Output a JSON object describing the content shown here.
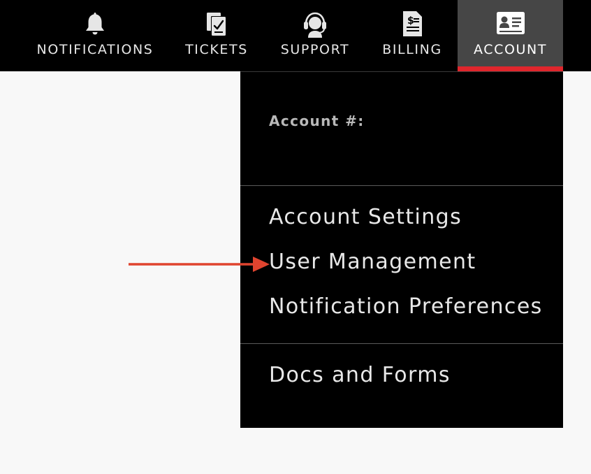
{
  "nav": {
    "items": [
      {
        "label": "NOTIFICATIONS",
        "icon": "bell-icon"
      },
      {
        "label": "TICKETS",
        "icon": "tickets-icon"
      },
      {
        "label": "SUPPORT",
        "icon": "headset-icon"
      },
      {
        "label": "BILLING",
        "icon": "invoice-icon"
      },
      {
        "label": "ACCOUNT",
        "icon": "id-card-icon",
        "active": true
      }
    ],
    "active_color": "#e0262c"
  },
  "account_menu": {
    "account_number_label": "Account #:",
    "items": [
      {
        "label": "Account Settings"
      },
      {
        "label": "User Management"
      },
      {
        "label": "Notification Preferences"
      },
      {
        "label": "Docs and Forms"
      }
    ]
  },
  "annotation": {
    "arrow_color": "#e0442f",
    "points_to": "User Management"
  }
}
